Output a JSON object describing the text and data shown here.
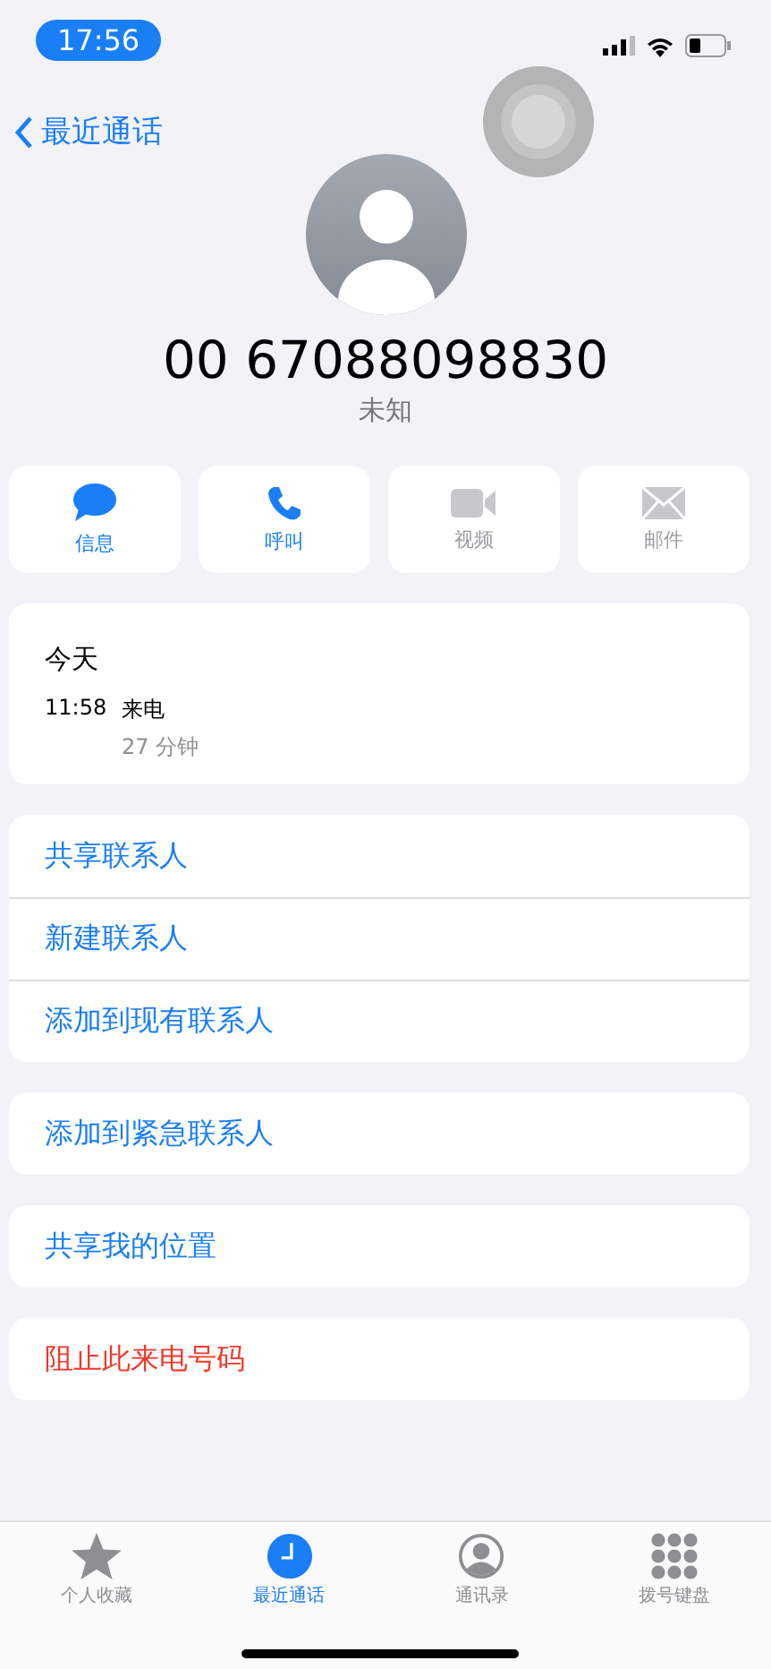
{
  "status_bar": {
    "time": "17:56"
  },
  "nav": {
    "back_label": "最近通话"
  },
  "contact": {
    "number": "00 67088098830",
    "label": "未知"
  },
  "actions": [
    {
      "kind": "message",
      "label": "信息",
      "disabled": false
    },
    {
      "kind": "call",
      "label": "呼叫",
      "disabled": false
    },
    {
      "kind": "video",
      "label": "视频",
      "disabled": true
    },
    {
      "kind": "mail",
      "label": "邮件",
      "disabled": true
    }
  ],
  "recents": {
    "day": "今天",
    "calls": [
      {
        "time": "11:58",
        "type": "来电",
        "duration": "27 分钟"
      }
    ]
  },
  "groups": [
    {
      "items": [
        {
          "label": "共享联系人",
          "kind": "normal"
        },
        {
          "label": "新建联系人",
          "kind": "normal"
        },
        {
          "label": "添加到现有联系人",
          "kind": "normal"
        }
      ]
    },
    {
      "items": [
        {
          "label": "添加到紧急联系人",
          "kind": "normal"
        }
      ]
    },
    {
      "items": [
        {
          "label": "共享我的位置",
          "kind": "normal"
        }
      ]
    },
    {
      "items": [
        {
          "label": "阻止此来电号码",
          "kind": "destructive"
        }
      ]
    }
  ],
  "tab_bar": [
    {
      "kind": "favorites",
      "label": "个人收藏",
      "selected": false
    },
    {
      "kind": "recents",
      "label": "最近通话",
      "selected": true
    },
    {
      "kind": "contacts",
      "label": "通讯录",
      "selected": false
    },
    {
      "kind": "keypad",
      "label": "拨号键盘",
      "selected": false
    }
  ]
}
